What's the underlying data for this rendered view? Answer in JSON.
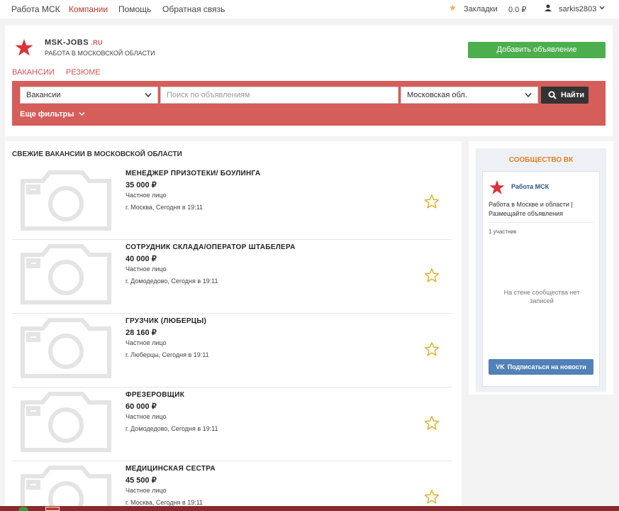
{
  "topnav": {
    "items": [
      "Работа МСК",
      "Компании",
      "Помощь",
      "Обратная связь"
    ],
    "bookmarks": "Закладки",
    "balance": "0.0 ₽",
    "username": "sarkis2803"
  },
  "header": {
    "logo_title": "MSK-JOBS",
    "logo_ru": ".RU",
    "logo_sub": "РАБОТА В МОСКОВСКОЙ ОБЛАСТИ",
    "add_button": "Добавить объявление",
    "tabs": [
      "ВАКАНСИИ",
      "РЕЗЮМЕ"
    ]
  },
  "search": {
    "category": "Вакансии",
    "placeholder": "Поиск по объявлениям",
    "region": "Московская обл.",
    "find_button": "Найти",
    "more_filters": "Еще фильтры"
  },
  "listings": {
    "title": "СВЕЖИЕ ВАКАНСИИ В МОСКОВСКОЙ ОБЛАСТИ",
    "items": [
      {
        "title": "МЕНЕДЖЕР ПРИЗОТЕКИ/ БОУЛИНГА",
        "price": "35 000 ₽",
        "type": "Частное лицо",
        "meta": "г. Москва, Сегодня в 19:11"
      },
      {
        "title": "СОТРУДНИК СКЛАДА/ОПЕРАТОР ШТАБЕЛЕРА",
        "price": "40 000 ₽",
        "type": "Частное лицо",
        "meta": "г. Домодедово, Сегодня в 19:11"
      },
      {
        "title": "ГРУЗЧИК (ЛЮБЕРЦЫ)",
        "price": "28 160 ₽",
        "type": "Частное лицо",
        "meta": "г. Люберцы, Сегодня в 19:11"
      },
      {
        "title": "ФРЕЗЕРОВЩИК",
        "price": "60 000 ₽",
        "type": "Частное лицо",
        "meta": "г. Домодедово, Сегодня в 19:11"
      },
      {
        "title": "МЕДИЦИНСКАЯ СЕСТРА",
        "price": "45 500 ₽",
        "type": "Частное лицо",
        "meta": "г. Москва, Сегодня в 19:11"
      }
    ]
  },
  "sidebar": {
    "title": "СООБЩЕСТВО ВК",
    "group_name": "Работа МСК",
    "group_desc": "Работа в Москве и области | Размещайте объявления",
    "members": "1 участник",
    "empty_wall": "На стене сообщества нет записей",
    "subscribe": "Подписаться на новости"
  },
  "colors": {
    "accent_red": "#d55d5a",
    "green_button": "#4cae4c",
    "vk_blue": "#5181b8",
    "sidebar_title": "#e67e22"
  },
  "icons": [
    "star-icon",
    "user-icon",
    "chevron-down-icon",
    "search-icon",
    "camera-placeholder-icon",
    "vk-icon"
  ]
}
